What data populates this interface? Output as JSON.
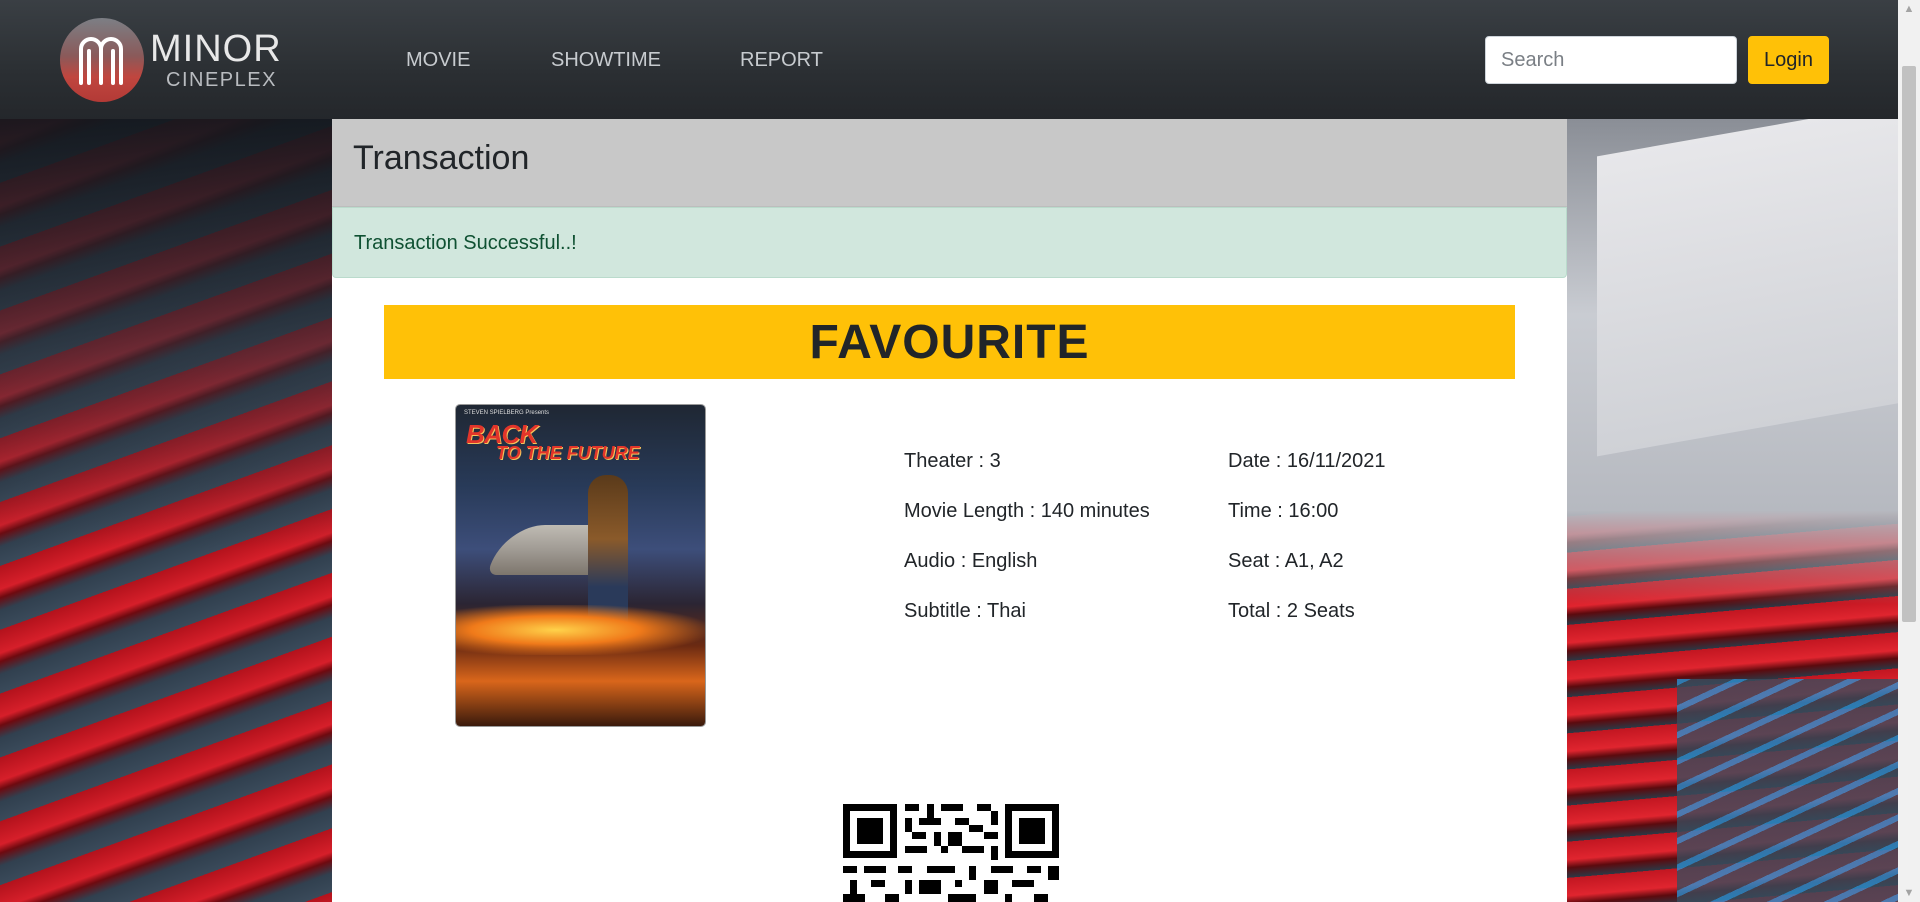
{
  "brand": {
    "name_top": "MINOR",
    "name_bottom": "CINEPLEX"
  },
  "nav": {
    "items": [
      "MOVIE",
      "SHOWTIME",
      "REPORT"
    ]
  },
  "search": {
    "placeholder": "Search",
    "value": ""
  },
  "auth": {
    "login_label": "Login"
  },
  "transaction": {
    "title": "Transaction",
    "alert": "Transaction Successful..!",
    "movie_title": "FAVOURITE",
    "poster": {
      "title_line1": "BACK",
      "title_line2": "TO THE FUTURE",
      "credit": "STEVEN SPIELBERG Presents"
    },
    "details": {
      "theater": "Theater : 3",
      "length": "Movie Length : 140 minutes",
      "audio": "Audio : English",
      "subtitle": "Subtitle : Thai",
      "date": "Date : 16/11/2021",
      "time": "Time : 16:00",
      "seat": "Seat : A1, A2",
      "total": "Total : 2 Seats"
    }
  },
  "colors": {
    "accent": "#ffc107",
    "navbar": "#2b2f33",
    "alert_bg": "#d1e7dd",
    "alert_text": "#0f5132",
    "header_bg": "#c8c8c8"
  }
}
